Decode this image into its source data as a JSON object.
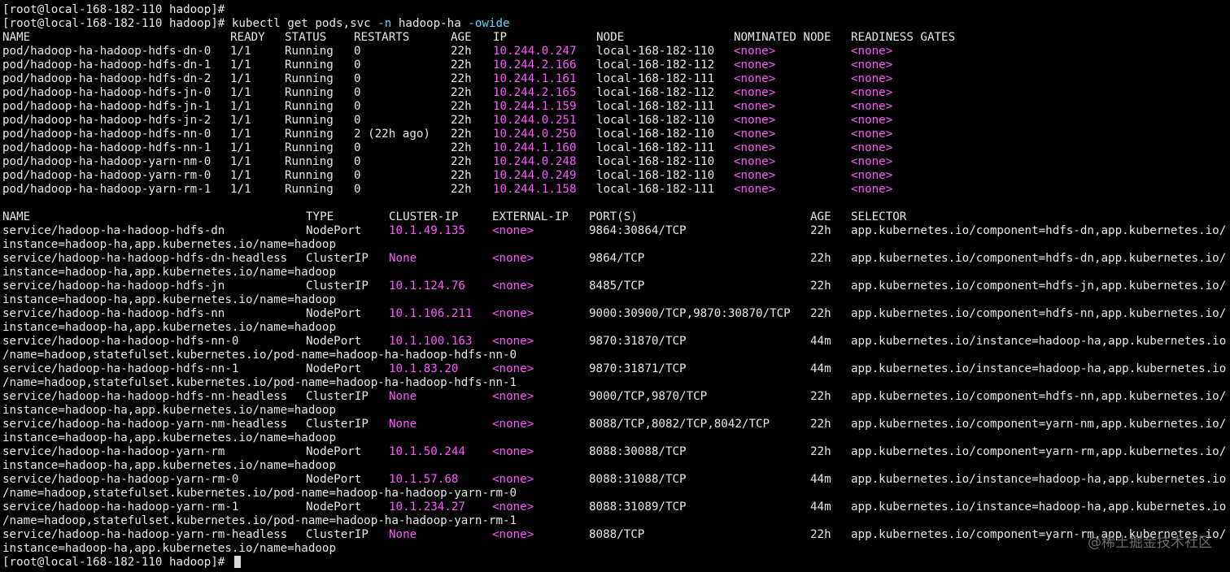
{
  "prompt": "[root@local-168-182-110 hadoop]# ",
  "first_prompt_line": "[root@local-168-182-110 hadoop]#",
  "command": {
    "cmd": "kubectl get pods,svc ",
    "flag_n": "-n",
    "ns": " hadoop-ha ",
    "flag_o": "-owide"
  },
  "pods_header": [
    "NAME",
    "READY",
    "STATUS",
    "RESTARTS",
    "AGE",
    "IP",
    "NODE",
    "NOMINATED NODE",
    "READINESS GATES"
  ],
  "pods": [
    [
      "pod/hadoop-ha-hadoop-hdfs-dn-0",
      "1/1",
      "Running",
      "0",
      "22h",
      "10.244.0.247",
      "local-168-182-110",
      "<none>",
      "<none>"
    ],
    [
      "pod/hadoop-ha-hadoop-hdfs-dn-1",
      "1/1",
      "Running",
      "0",
      "22h",
      "10.244.2.166",
      "local-168-182-112",
      "<none>",
      "<none>"
    ],
    [
      "pod/hadoop-ha-hadoop-hdfs-dn-2",
      "1/1",
      "Running",
      "0",
      "22h",
      "10.244.1.161",
      "local-168-182-111",
      "<none>",
      "<none>"
    ],
    [
      "pod/hadoop-ha-hadoop-hdfs-jn-0",
      "1/1",
      "Running",
      "0",
      "22h",
      "10.244.2.165",
      "local-168-182-112",
      "<none>",
      "<none>"
    ],
    [
      "pod/hadoop-ha-hadoop-hdfs-jn-1",
      "1/1",
      "Running",
      "0",
      "22h",
      "10.244.1.159",
      "local-168-182-111",
      "<none>",
      "<none>"
    ],
    [
      "pod/hadoop-ha-hadoop-hdfs-jn-2",
      "1/1",
      "Running",
      "0",
      "22h",
      "10.244.0.251",
      "local-168-182-110",
      "<none>",
      "<none>"
    ],
    [
      "pod/hadoop-ha-hadoop-hdfs-nn-0",
      "1/1",
      "Running",
      "2 (22h ago)",
      "22h",
      "10.244.0.250",
      "local-168-182-110",
      "<none>",
      "<none>"
    ],
    [
      "pod/hadoop-ha-hadoop-hdfs-nn-1",
      "1/1",
      "Running",
      "0",
      "22h",
      "10.244.1.160",
      "local-168-182-111",
      "<none>",
      "<none>"
    ],
    [
      "pod/hadoop-ha-hadoop-yarn-nm-0",
      "1/1",
      "Running",
      "0",
      "22h",
      "10.244.0.248",
      "local-168-182-110",
      "<none>",
      "<none>"
    ],
    [
      "pod/hadoop-ha-hadoop-yarn-rm-0",
      "1/1",
      "Running",
      "0",
      "22h",
      "10.244.0.249",
      "local-168-182-110",
      "<none>",
      "<none>"
    ],
    [
      "pod/hadoop-ha-hadoop-yarn-rm-1",
      "1/1",
      "Running",
      "0",
      "22h",
      "10.244.1.158",
      "local-168-182-111",
      "<none>",
      "<none>"
    ]
  ],
  "svc_header": [
    "NAME",
    "TYPE",
    "CLUSTER-IP",
    "EXTERNAL-IP",
    "PORT(S)",
    "AGE",
    "SELECTOR"
  ],
  "services": [
    {
      "cells": [
        "service/hadoop-ha-hadoop-hdfs-dn",
        "NodePort",
        "10.1.49.135",
        "<none>",
        "9864:30864/TCP",
        "22h",
        "app.kubernetes.io/component=hdfs-dn,app.kubernetes.io/"
      ],
      "cont": "instance=hadoop-ha,app.kubernetes.io/name=hadoop"
    },
    {
      "cells": [
        "service/hadoop-ha-hadoop-hdfs-dn-headless",
        "ClusterIP",
        "None",
        "<none>",
        "9864/TCP",
        "22h",
        "app.kubernetes.io/component=hdfs-dn,app.kubernetes.io/"
      ],
      "cont": "instance=hadoop-ha,app.kubernetes.io/name=hadoop"
    },
    {
      "cells": [
        "service/hadoop-ha-hadoop-hdfs-jn",
        "ClusterIP",
        "10.1.124.76",
        "<none>",
        "8485/TCP",
        "22h",
        "app.kubernetes.io/component=hdfs-jn,app.kubernetes.io/"
      ],
      "cont": "instance=hadoop-ha,app.kubernetes.io/name=hadoop"
    },
    {
      "cells": [
        "service/hadoop-ha-hadoop-hdfs-nn",
        "NodePort",
        "10.1.106.211",
        "<none>",
        "9000:30900/TCP,9870:30870/TCP",
        "22h",
        "app.kubernetes.io/component=hdfs-nn,app.kubernetes.io/"
      ],
      "cont": "instance=hadoop-ha,app.kubernetes.io/name=hadoop"
    },
    {
      "cells": [
        "service/hadoop-ha-hadoop-hdfs-nn-0",
        "NodePort",
        "10.1.100.163",
        "<none>",
        "9870:31870/TCP",
        "44m",
        "app.kubernetes.io/instance=hadoop-ha,app.kubernetes.io"
      ],
      "cont": "/name=hadoop,statefulset.kubernetes.io/pod-name=hadoop-ha-hadoop-hdfs-nn-0"
    },
    {
      "cells": [
        "service/hadoop-ha-hadoop-hdfs-nn-1",
        "NodePort",
        "10.1.83.20",
        "<none>",
        "9870:31871/TCP",
        "44m",
        "app.kubernetes.io/instance=hadoop-ha,app.kubernetes.io"
      ],
      "cont": "/name=hadoop,statefulset.kubernetes.io/pod-name=hadoop-ha-hadoop-hdfs-nn-1"
    },
    {
      "cells": [
        "service/hadoop-ha-hadoop-hdfs-nn-headless",
        "ClusterIP",
        "None",
        "<none>",
        "9000/TCP,9870/TCP",
        "22h",
        "app.kubernetes.io/component=hdfs-nn,app.kubernetes.io/"
      ],
      "cont": "instance=hadoop-ha,app.kubernetes.io/name=hadoop"
    },
    {
      "cells": [
        "service/hadoop-ha-hadoop-yarn-nm-headless",
        "ClusterIP",
        "None",
        "<none>",
        "8088/TCP,8082/TCP,8042/TCP",
        "22h",
        "app.kubernetes.io/component=yarn-nm,app.kubernetes.io/"
      ],
      "cont": "instance=hadoop-ha,app.kubernetes.io/name=hadoop"
    },
    {
      "cells": [
        "service/hadoop-ha-hadoop-yarn-rm",
        "NodePort",
        "10.1.50.244",
        "<none>",
        "8088:30088/TCP",
        "22h",
        "app.kubernetes.io/component=yarn-rm,app.kubernetes.io/"
      ],
      "cont": "instance=hadoop-ha,app.kubernetes.io/name=hadoop"
    },
    {
      "cells": [
        "service/hadoop-ha-hadoop-yarn-rm-0",
        "NodePort",
        "10.1.57.68",
        "<none>",
        "8088:31088/TCP",
        "44m",
        "app.kubernetes.io/instance=hadoop-ha,app.kubernetes.io"
      ],
      "cont": "/name=hadoop,statefulset.kubernetes.io/pod-name=hadoop-ha-hadoop-yarn-rm-0"
    },
    {
      "cells": [
        "service/hadoop-ha-hadoop-yarn-rm-1",
        "NodePort",
        "10.1.234.27",
        "<none>",
        "8088:31089/TCP",
        "44m",
        "app.kubernetes.io/instance=hadoop-ha,app.kubernetes.io"
      ],
      "cont": "/name=hadoop,statefulset.kubernetes.io/pod-name=hadoop-ha-hadoop-yarn-rm-1"
    },
    {
      "cells": [
        "service/hadoop-ha-hadoop-yarn-rm-headless",
        "ClusterIP",
        "None",
        "<none>",
        "8088/TCP",
        "22h",
        "app.kubernetes.io/component=yarn-rm,app.kubernetes.io/"
      ],
      "cont": "instance=hadoop-ha,app.kubernetes.io/name=hadoop"
    }
  ],
  "watermark": "@稀土掘金技术社区",
  "colors": {
    "background": "#000000",
    "text": "#e6e6e6",
    "highlight": "#ff55ff",
    "flag": "#5fd7ff"
  },
  "icons": [
    "cursor-block-icon"
  ]
}
